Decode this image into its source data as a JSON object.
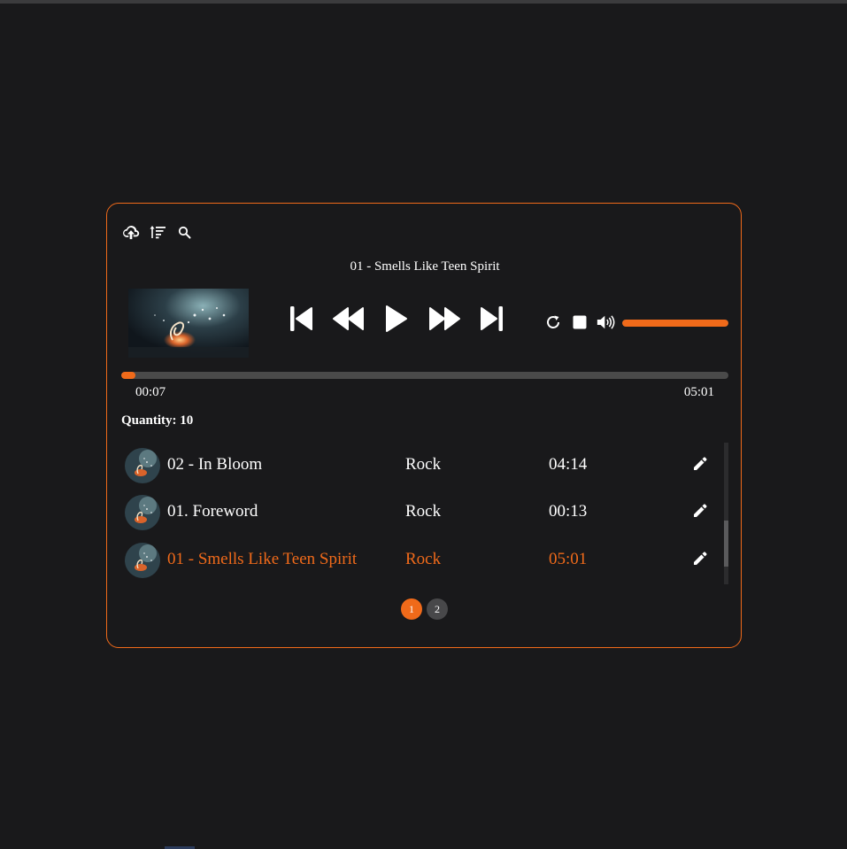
{
  "colors": {
    "accent": "#f06a1a",
    "background": "#19191b",
    "text": "#ffffff",
    "track": "#4a4a4a"
  },
  "toolbar": {
    "icons": [
      "cloud-upload-icon",
      "sort-icon",
      "search-icon"
    ]
  },
  "now_playing": {
    "title": "01 - Smells Like Teen Spirit",
    "current_time": "00:07",
    "total_time": "05:01",
    "progress": 0.023,
    "volume": 1.0
  },
  "controls": {
    "icons": [
      "skip-previous-icon",
      "rewind-icon",
      "play-icon",
      "fast-forward-icon",
      "skip-next-icon"
    ],
    "secondary_icons": [
      "repeat-icon",
      "stop-icon",
      "volume-icon"
    ]
  },
  "playlist": {
    "quantity_label": "Quantity:",
    "quantity": "10",
    "tracks": [
      {
        "title": "02 - In Bloom",
        "genre": "Rock",
        "duration": "04:14",
        "active": false
      },
      {
        "title": "01. Foreword",
        "genre": "Rock",
        "duration": "00:13",
        "active": false
      },
      {
        "title": "01 - Smells Like Teen Spirit",
        "genre": "Rock",
        "duration": "05:01",
        "active": true
      }
    ]
  },
  "pagination": {
    "pages": [
      "1",
      "2"
    ],
    "current": "1"
  }
}
